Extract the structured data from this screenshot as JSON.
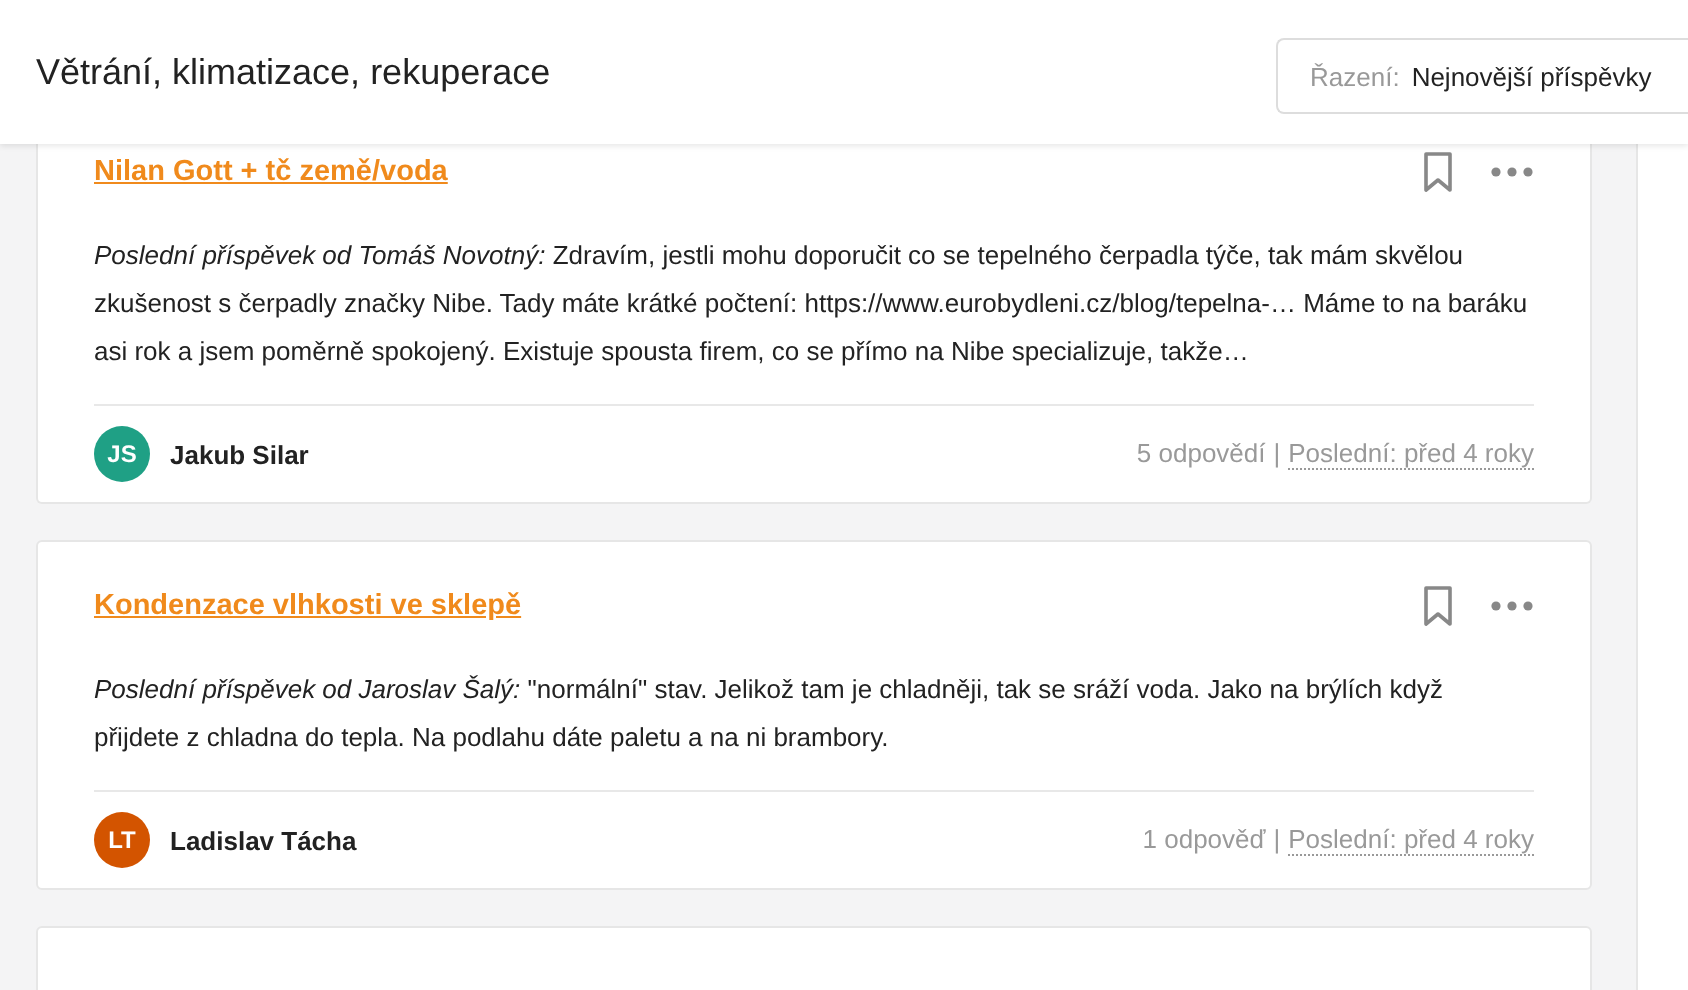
{
  "header": {
    "title": "Větrání, klimatizace, rekuperace",
    "sort": {
      "label": "Řazení:",
      "value": "Nejnovější příspěvky"
    }
  },
  "topics": [
    {
      "title": "Nilan Gott + tč země/voda",
      "excerpt": "*Poslední příspěvek od Tomáš Novotný:* Zdravím, jestli mohu doporučit co se tepelného čerpadla týče, tak mám skvělou zkušenost s čerpadly značky Nibe. Tady máte krátké počtení: https://www.eurobydleni.cz/blog/tepelna-… Máme to na baráku asi rok a jsem poměrně spokojený. Existuje spousta firem, co se přímo na Nibe specializuje, takže…",
      "author": {
        "initials": "JS",
        "name": "Jakub Silar",
        "color": "#1fa085"
      },
      "replies": "5 odpovědí",
      "separator": "|",
      "last": "Poslední: před 4 roky"
    },
    {
      "title": "Kondenzace vlhkosti ve sklepě",
      "excerpt": "*Poslední příspěvek od Jaroslav Šalý:* \"normální\" stav. Jelikož tam je chladněji, tak se sráží voda. Jako na brýlích když přijdete z chladna do tepla. Na podlahu dáte paletu a na ni brambory.",
      "author": {
        "initials": "LT",
        "name": "Ladislav Tácha",
        "color": "#d35400"
      },
      "replies": "1 odpověď",
      "separator": "|",
      "last": "Poslední: před 4 roky"
    }
  ]
}
